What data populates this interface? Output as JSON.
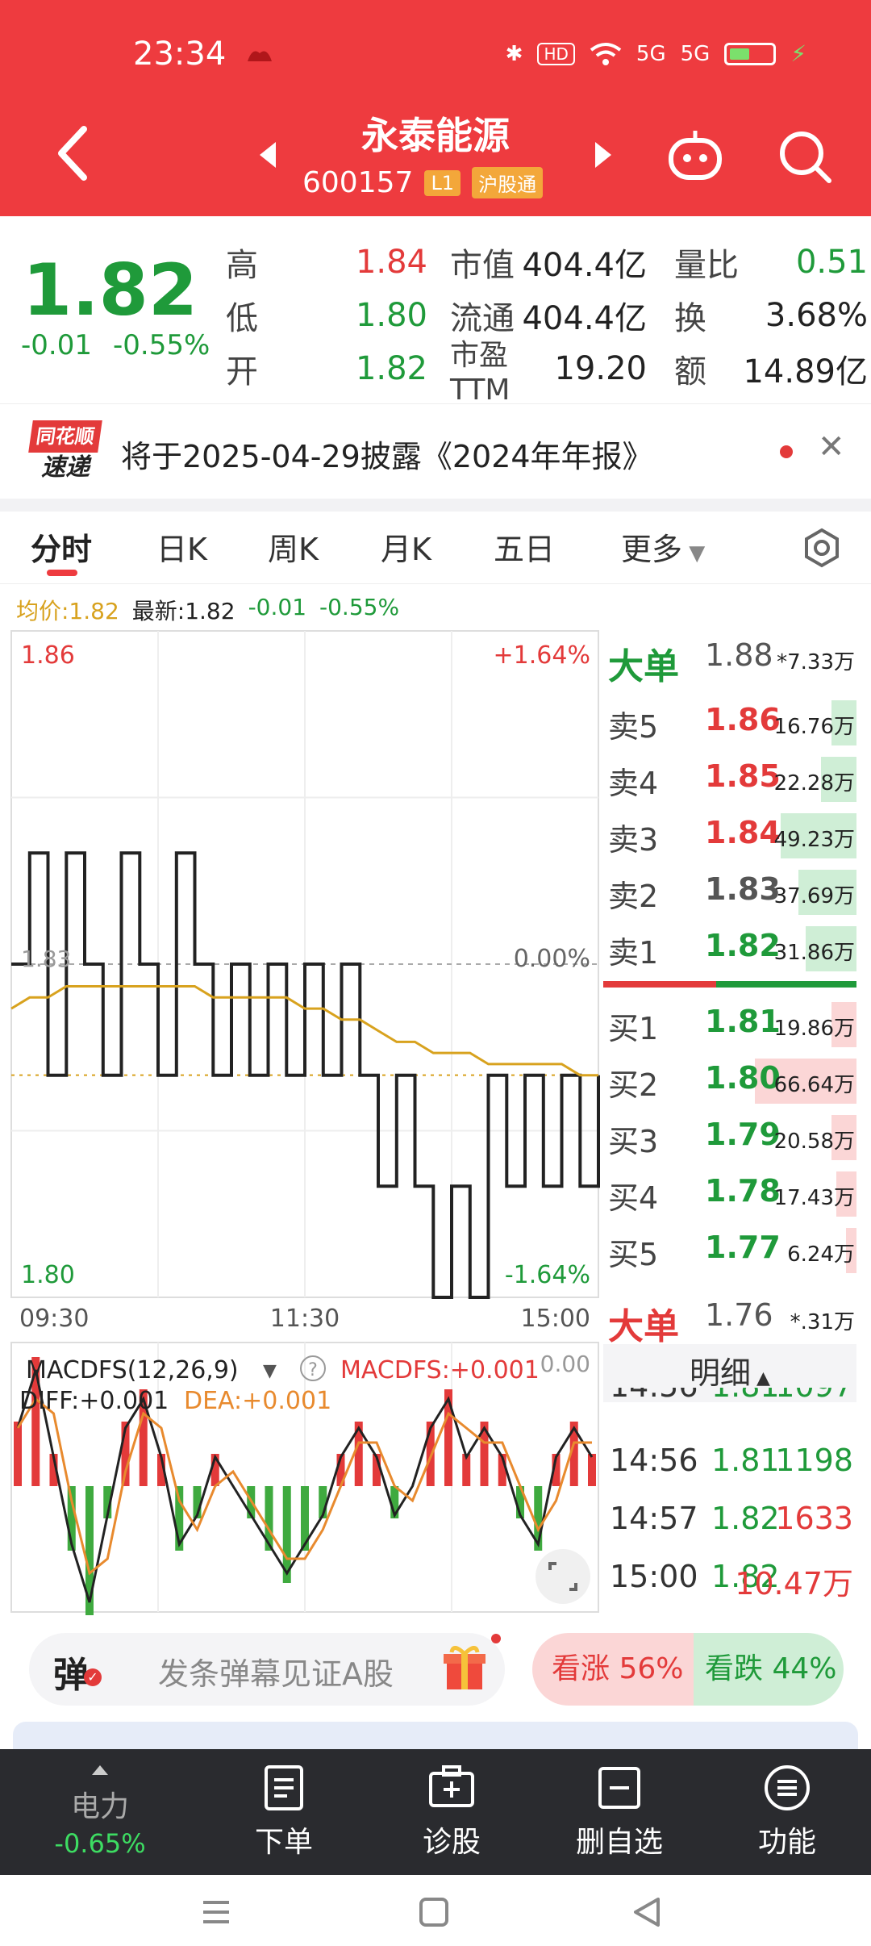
{
  "status_bar": {
    "time": "23:34",
    "hd": "HD",
    "net1": "5G",
    "net2": "5G"
  },
  "header": {
    "title": "永泰能源",
    "code": "600157",
    "level_tag": "L1",
    "market_tag": "沪股通"
  },
  "quote": {
    "price": "1.82",
    "change_abs": "-0.01",
    "change_pct": "-0.55%",
    "high_label": "高",
    "high": "1.84",
    "low_label": "低",
    "low": "1.80",
    "open_label": "开",
    "open": "1.82",
    "mcap_label": "市值",
    "mcap": "404.4亿",
    "float_label": "流通",
    "float": "404.4亿",
    "pe_label": "市盈TTM",
    "pe": "19.20",
    "ratio_label": "量比",
    "ratio": "0.51",
    "turnover_label": "换",
    "turnover": "3.68%",
    "amount_label": "额",
    "amount": "14.89亿"
  },
  "notice": {
    "logo_top": "同花顺",
    "logo_bottom": "速递",
    "text": "将于2025-04-29披露《2024年年报》"
  },
  "tabs": [
    "分时",
    "日K",
    "周K",
    "月K",
    "五日",
    "更多"
  ],
  "price_line": {
    "avg": "均价:1.82",
    "latest": "最新:1.82",
    "chg": "-0.01",
    "pct": "-0.55%"
  },
  "chart_labels": {
    "top_price": "1.86",
    "top_pct": "+1.64%",
    "mid_price": "1.83",
    "mid_pct": "0.00%",
    "bot_price": "1.80",
    "bot_pct": "-1.64%",
    "t_start": "09:30",
    "t_mid": "11:30",
    "t_end": "15:00",
    "macd_title": "MACDFS(12,26,9)",
    "macd_val": "MACDFS:+0.001",
    "diff": "DIFF:+0.001",
    "dea": "DEA:+0.001",
    "macd_zero": "0.00"
  },
  "chart_data": {
    "type": "line",
    "ylim": [
      1.8,
      1.86
    ],
    "x": [
      "09:30",
      "11:30",
      "15:00"
    ],
    "series": [
      {
        "name": "最新",
        "values": [
          1.83,
          1.84,
          1.82,
          1.84,
          1.83,
          1.82,
          1.84,
          1.83,
          1.82,
          1.84,
          1.83,
          1.82,
          1.83,
          1.82,
          1.83,
          1.82,
          1.83,
          1.82,
          1.83,
          1.82,
          1.81,
          1.82,
          1.81,
          1.8,
          1.81,
          1.8,
          1.82,
          1.81,
          1.82,
          1.81,
          1.82,
          1.81,
          1.82
        ]
      },
      {
        "name": "均价",
        "values": [
          1.826,
          1.827,
          1.827,
          1.828,
          1.828,
          1.828,
          1.828,
          1.828,
          1.828,
          1.828,
          1.828,
          1.827,
          1.827,
          1.827,
          1.827,
          1.827,
          1.826,
          1.826,
          1.825,
          1.825,
          1.824,
          1.823,
          1.823,
          1.822,
          1.822,
          1.822,
          1.821,
          1.821,
          1.821,
          1.821,
          1.821,
          1.82,
          1.82
        ]
      }
    ],
    "macd": [
      0.002,
      0.004,
      0.001,
      -0.002,
      -0.004,
      -0.001,
      0.002,
      0.003,
      0.001,
      -0.002,
      -0.001,
      0.001,
      0.0,
      -0.001,
      -0.002,
      -0.003,
      -0.002,
      -0.001,
      0.001,
      0.002,
      0.001,
      -0.001,
      0.0,
      0.002,
      0.003,
      0.001,
      0.002,
      0.001,
      -0.001,
      -0.002,
      0.001,
      0.002,
      0.001
    ]
  },
  "book": {
    "big_sell": {
      "label": "大单",
      "price": "1.88",
      "vol": "*7.33万"
    },
    "sells": [
      {
        "label": "卖5",
        "price": "1.86",
        "vol": "16.76万",
        "bar": 0.1
      },
      {
        "label": "卖4",
        "price": "1.85",
        "vol": "22.28万",
        "bar": 0.14
      },
      {
        "label": "卖3",
        "price": "1.84",
        "vol": "49.23万",
        "bar": 0.3
      },
      {
        "label": "卖2",
        "price": "1.83",
        "vol": "37.69万",
        "bar": 0.23
      },
      {
        "label": "卖1",
        "price": "1.82",
        "vol": "31.86万",
        "bar": 0.2
      }
    ],
    "buys": [
      {
        "label": "买1",
        "price": "1.81",
        "vol": "19.86万",
        "bar": 0.1
      },
      {
        "label": "买2",
        "price": "1.80",
        "vol": "66.64万",
        "bar": 0.4
      },
      {
        "label": "买3",
        "price": "1.79",
        "vol": "20.58万",
        "bar": 0.1
      },
      {
        "label": "买4",
        "price": "1.78",
        "vol": "17.43万",
        "bar": 0.08
      },
      {
        "label": "买5",
        "price": "1.77",
        "vol": "6.24万",
        "bar": 0.04
      }
    ],
    "big_buy": {
      "label": "大单",
      "price": "1.76",
      "vol": "*.31万"
    },
    "detail": "明细",
    "trades": [
      {
        "time": "14:56",
        "price": "1.81",
        "vol": "1097"
      },
      {
        "time": "14:56",
        "price": "1.81",
        "vol": "1198"
      },
      {
        "time": "14:57",
        "price": "1.82",
        "vol": "1633"
      },
      {
        "time": "15:00",
        "price": "1.82",
        "vol": "10.47万"
      }
    ]
  },
  "danmu": {
    "label": "弹",
    "placeholder": "发条弹幕见证A股"
  },
  "vote": {
    "up": "看涨 56%",
    "down": "看跌 44%"
  },
  "toolbar": {
    "power_name": "电力",
    "power_val": "-0.65%",
    "order": "下单",
    "diagnose": "诊股",
    "remove": "删自选",
    "func": "功能"
  },
  "colors": {
    "header_red": "#ee3b3f",
    "up": "#e33a3a",
    "down": "#1f9a3a",
    "avg_line": "#d8a21e"
  }
}
